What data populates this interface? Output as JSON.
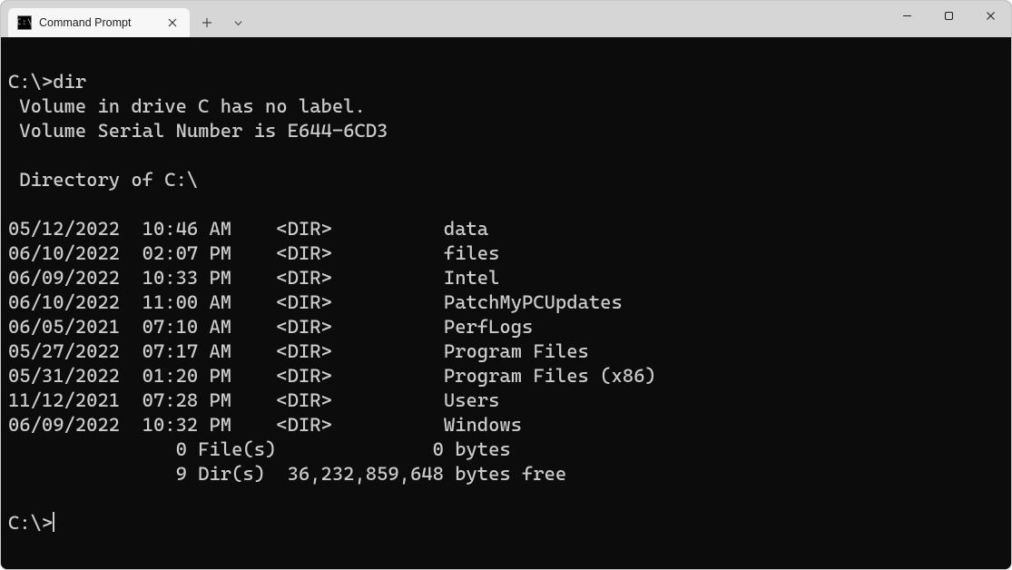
{
  "window": {
    "tab_title": "Command Prompt"
  },
  "terminal": {
    "prompt": "C:\\>",
    "command": "dir",
    "info_lines": [
      " Volume in drive C has no label.",
      " Volume Serial Number is E644-6CD3",
      "",
      " Directory of C:\\",
      ""
    ],
    "entries": [
      {
        "date": "05/12/2022",
        "time": "10:46 AM",
        "type": "<DIR>",
        "size": "",
        "name": "data"
      },
      {
        "date": "06/10/2022",
        "time": "02:07 PM",
        "type": "<DIR>",
        "size": "",
        "name": "files"
      },
      {
        "date": "06/09/2022",
        "time": "10:33 PM",
        "type": "<DIR>",
        "size": "",
        "name": "Intel"
      },
      {
        "date": "06/10/2022",
        "time": "11:00 AM",
        "type": "<DIR>",
        "size": "",
        "name": "PatchMyPCUpdates"
      },
      {
        "date": "06/05/2021",
        "time": "07:10 AM",
        "type": "<DIR>",
        "size": "",
        "name": "PerfLogs"
      },
      {
        "date": "05/27/2022",
        "time": "07:17 AM",
        "type": "<DIR>",
        "size": "",
        "name": "Program Files"
      },
      {
        "date": "05/31/2022",
        "time": "01:20 PM",
        "type": "<DIR>",
        "size": "",
        "name": "Program Files (x86)"
      },
      {
        "date": "11/12/2021",
        "time": "07:28 PM",
        "type": "<DIR>",
        "size": "",
        "name": "Users"
      },
      {
        "date": "06/09/2022",
        "time": "10:32 PM",
        "type": "<DIR>",
        "size": "",
        "name": "Windows"
      }
    ],
    "summary": {
      "files_line": "               0 File(s)              0 bytes",
      "dirs_line": "               9 Dir(s)  36,232,859,648 bytes free"
    },
    "final_prompt": "C:\\>"
  }
}
